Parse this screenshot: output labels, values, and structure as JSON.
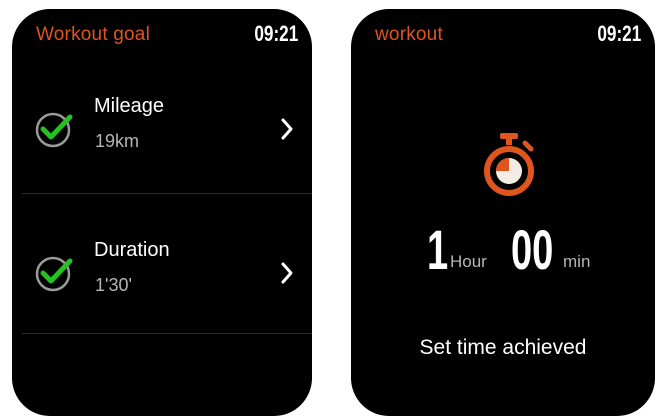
{
  "left_screen": {
    "title": "Workout goal",
    "time": "09:21",
    "rows": [
      {
        "label": "Mileage",
        "value": "19km",
        "checked": true
      },
      {
        "label": "Duration",
        "value": "1'30'",
        "checked": true
      }
    ]
  },
  "right_screen": {
    "title": "workout",
    "time": "09:21",
    "hours_value": "1",
    "hours_unit": "Hour",
    "minutes_value": "00",
    "minutes_unit": "min",
    "message": "Set time achieved"
  },
  "icons": {
    "check": "check-circle-icon",
    "chevron": "chevron-right-icon",
    "stopwatch": "stopwatch-icon"
  },
  "colors": {
    "accent": "#e0541d",
    "check_green": "#22c21f",
    "ring_gray": "#9a9a9a",
    "background": "#000000"
  }
}
